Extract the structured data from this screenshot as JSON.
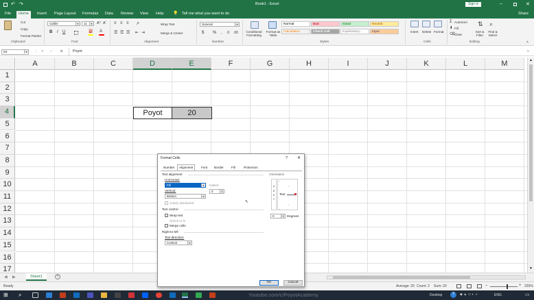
{
  "window": {
    "title": "Book1 - Excel",
    "sign_in": "Sign in",
    "share": "Share"
  },
  "ribbon_tabs": [
    "File",
    "Home",
    "Insert",
    "Page Layout",
    "Formulas",
    "Data",
    "Review",
    "View",
    "Help"
  ],
  "tell_me": "Tell me what you want to do",
  "clipboard": {
    "cut": "Cut",
    "copy": "Copy",
    "format_painter": "Format Painter",
    "label": "Clipboard"
  },
  "font": {
    "name": "Calibri",
    "size": "11",
    "label": "Font"
  },
  "alignment": {
    "wrap_text": "Wrap Text",
    "merge_center": "Merge & Center",
    "label": "Alignment"
  },
  "number": {
    "format": "General",
    "label": "Number"
  },
  "styles": {
    "conditional_formatting": "Conditional Formatting",
    "format_as_table": "Format as Table",
    "cells": [
      {
        "name": "Normal",
        "bg": "#ffffff",
        "fg": "#000000"
      },
      {
        "name": "Bad",
        "bg": "#ffc7ce",
        "fg": "#9c0006"
      },
      {
        "name": "Good",
        "bg": "#c6efce",
        "fg": "#006100"
      },
      {
        "name": "Neutral",
        "bg": "#ffeb9c",
        "fg": "#9c5700"
      },
      {
        "name": "Calculation",
        "bg": "#f2f2f2",
        "fg": "#fa7d00"
      },
      {
        "name": "Check Cell",
        "bg": "#a5a5a5",
        "fg": "#ffffff"
      },
      {
        "name": "Explanatory...",
        "bg": "#ffffff",
        "fg": "#7f7f7f"
      },
      {
        "name": "Input",
        "bg": "#ffcc99",
        "fg": "#3f3f76"
      }
    ],
    "label": "Styles"
  },
  "cells_group": {
    "insert": "Insert",
    "delete": "Delete",
    "format": "Format",
    "label": "Cells"
  },
  "editing": {
    "autosum": "AutoSum",
    "fill": "Fill",
    "clear": "Clear",
    "sort_filter": "Sort & Filter",
    "find_select": "Find & Select",
    "label": "Editing"
  },
  "formula_bar": {
    "name_box": "D4",
    "fx": "fx",
    "content": "Poyot"
  },
  "columns": [
    "A",
    "B",
    "C",
    "D",
    "E",
    "F",
    "G",
    "H",
    "I",
    "J",
    "K",
    "L",
    "M"
  ],
  "rows": [
    "1",
    "2",
    "3",
    "4",
    "5",
    "6",
    "7",
    "8",
    "9",
    "10",
    "11",
    "12",
    "13",
    "14",
    "15",
    "16",
    "17"
  ],
  "cells": {
    "D4": "Poyot",
    "E4": "20"
  },
  "sheet_tab": "Sheet1",
  "status": {
    "ready": "Ready",
    "average": "Average: 20",
    "count": "Count: 2",
    "sum": "Sum: 20",
    "zoom": "220%"
  },
  "dialog": {
    "title": "Format Cells",
    "help": "?",
    "close": "✕",
    "tabs": [
      "Number",
      "Alignment",
      "Font",
      "Border",
      "Fill",
      "Protection"
    ],
    "text_alignment": "Text alignment",
    "horizontal": "Horizontal:",
    "horizontal_value": "Fill",
    "indent": "Indent:",
    "indent_value": "0",
    "vertical": "Vertical:",
    "vertical_value": "Bottom",
    "justify_distributed": "Justify distributed",
    "text_control": "Text control",
    "wrap_text": "Wrap text",
    "shrink_to_fit": "Shrink to fit",
    "merge_cells": "Merge cells",
    "right_to_left": "Right-to-left",
    "text_direction": "Text direction:",
    "text_direction_value": "Context",
    "orientation": "Orientation",
    "orientation_text": "Text",
    "vertical_text": [
      "T",
      "e",
      "x",
      "t"
    ],
    "degrees_value": "0",
    "degrees": "Degrees",
    "ok": "OK",
    "cancel": "Cancel"
  },
  "taskbar": {
    "watermark": "Youtube.com/c/PoyotAcademy",
    "desktop": "Desktop",
    "lang": "ENG"
  }
}
